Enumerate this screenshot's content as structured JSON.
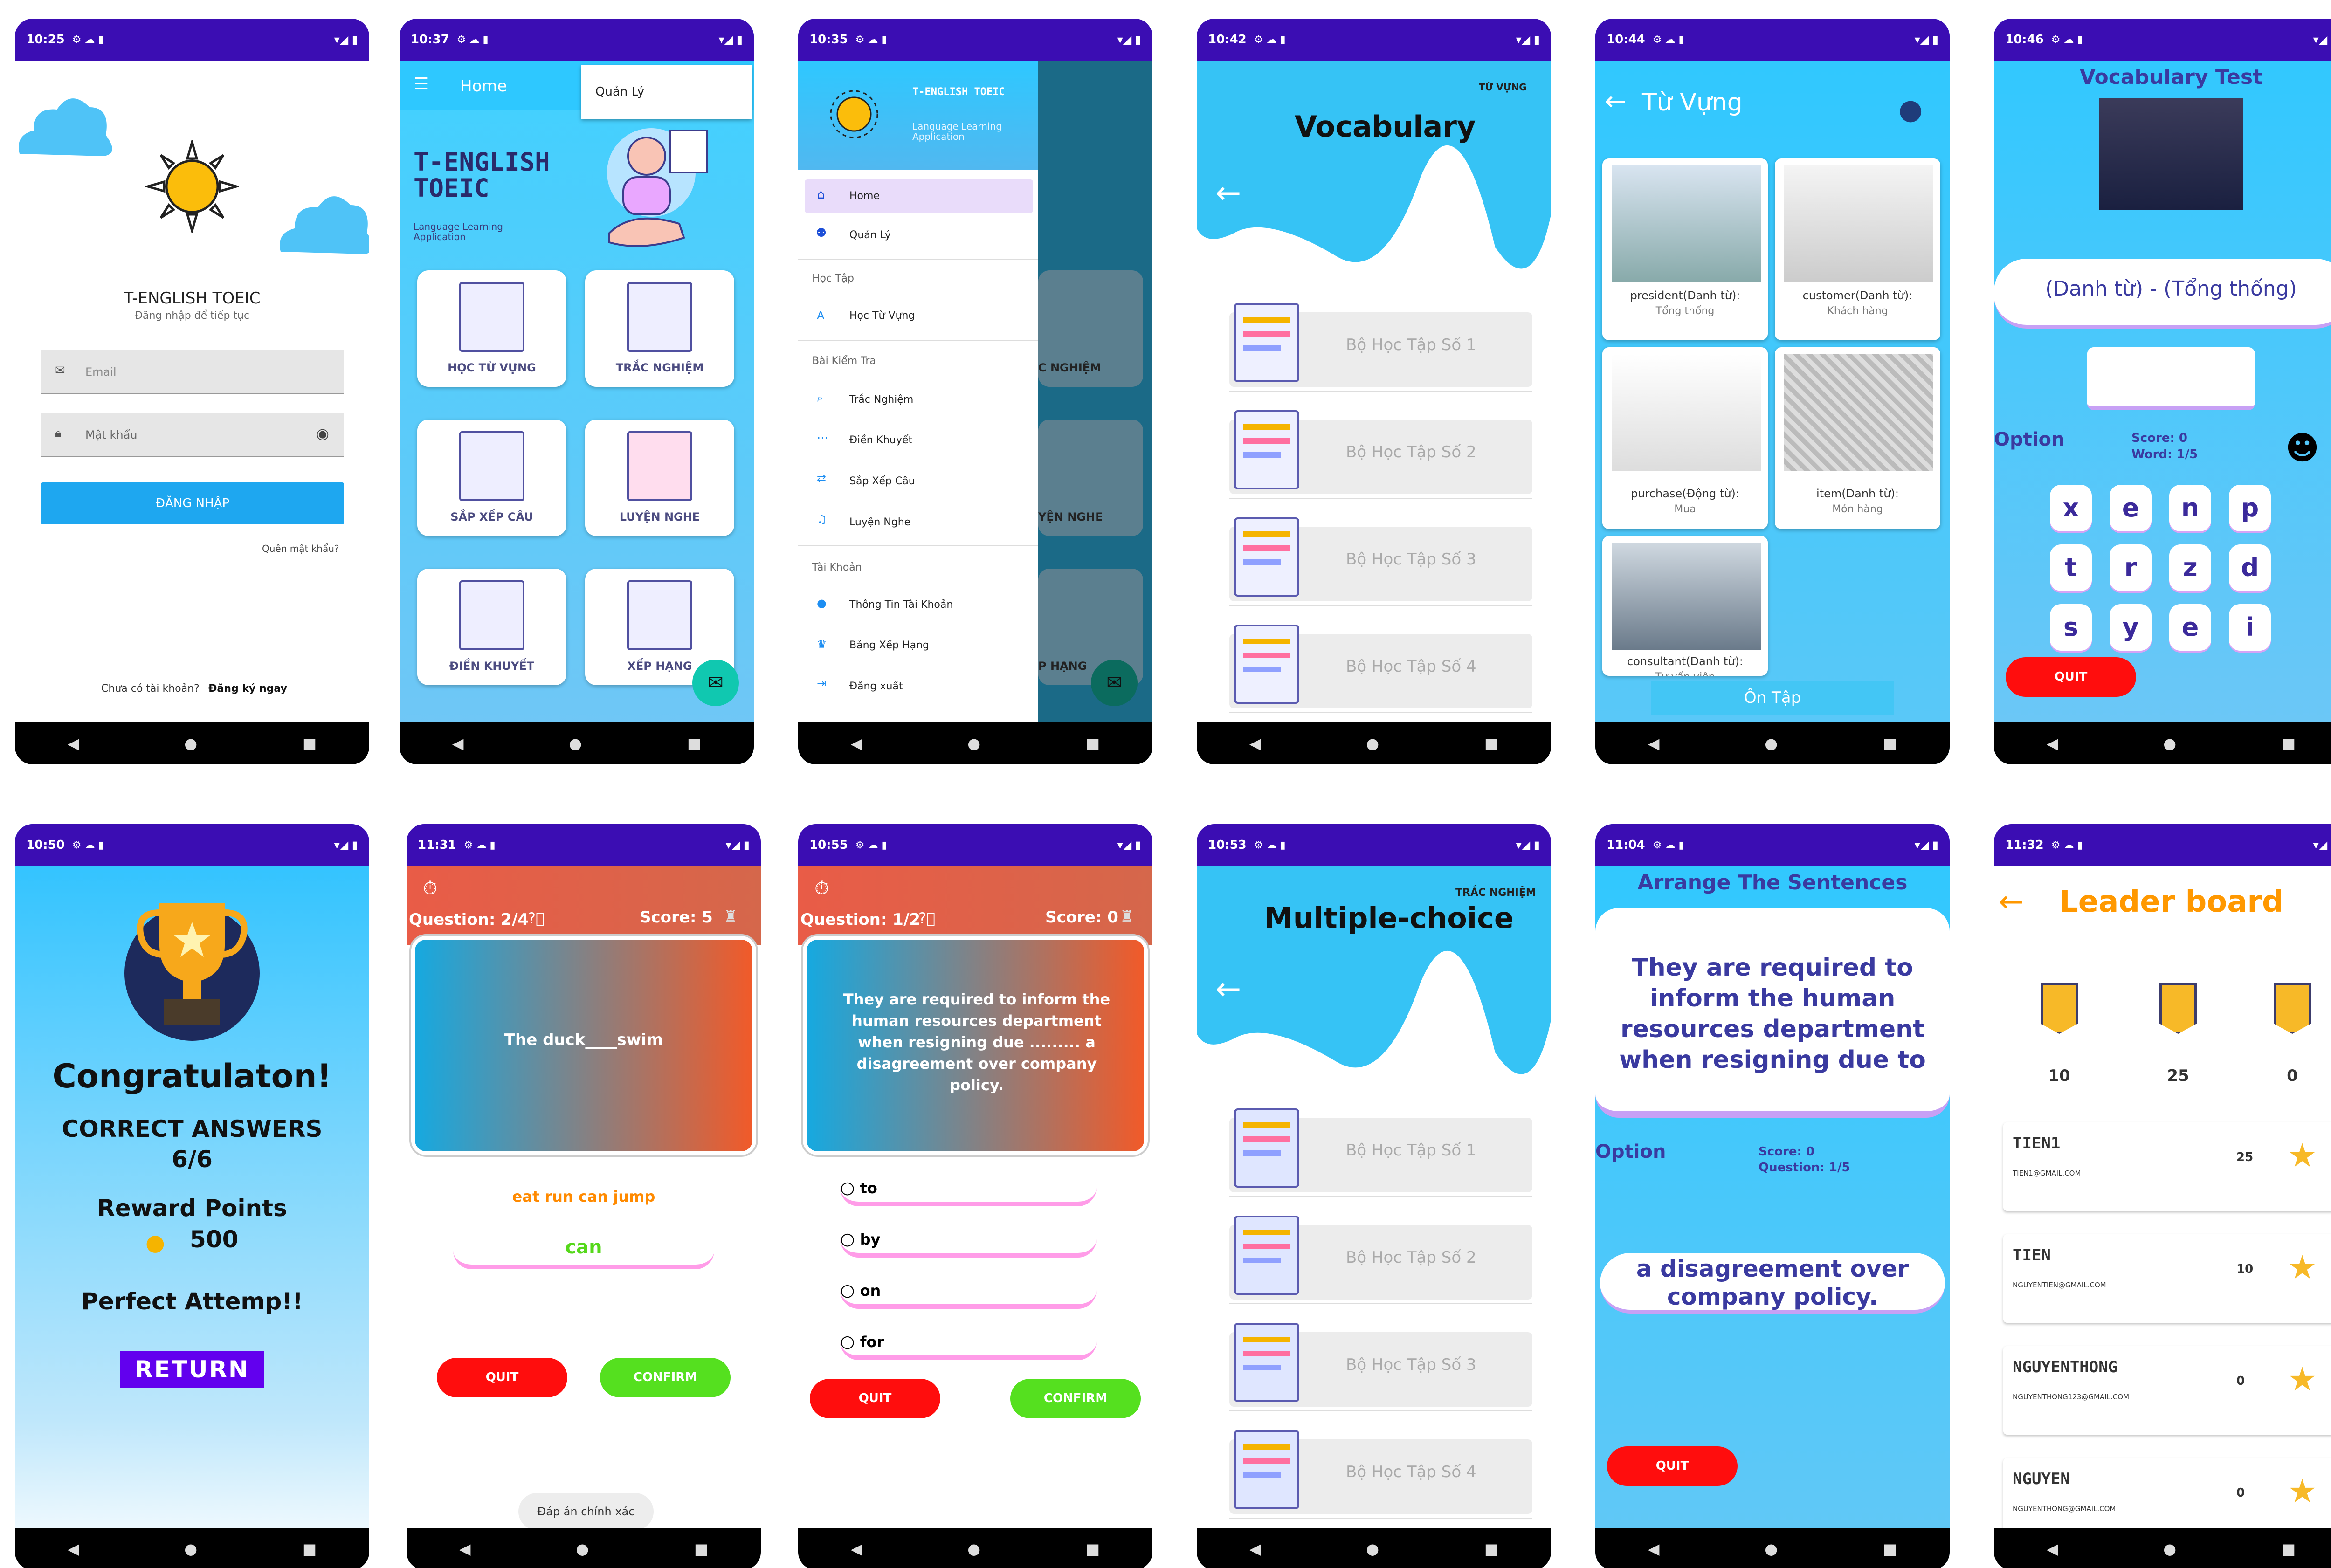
{
  "status": {
    "p1": "10:25",
    "p2": "10:37",
    "p3": "10:35",
    "p4": "10:42",
    "p5": "10:44",
    "p6": "10:46",
    "p7": "10:50",
    "p8": "11:31",
    "p9": "10:55",
    "p10": "10:53",
    "p11": "11:04",
    "p12": "11:32"
  },
  "login": {
    "title": "T-ENGLISH TOEIC",
    "subtitle": "Đăng nhập để tiếp tục",
    "email_placeholder": "Email",
    "password_placeholder": "Mật khẩu",
    "login_button": "ĐĂNG NHẬP",
    "forgot": "Quên mật khẩu?",
    "no_account": "Chưa có tài khoản?",
    "register": "Đăng ký ngay"
  },
  "home": {
    "toolbar_title": "Home",
    "popup_item": "Quản Lý",
    "brand_title_1": "T-ENGLISH",
    "brand_title_2": "TOEIC",
    "brand_sub_1": "Language Learning",
    "brand_sub_2": "Application",
    "tiles": [
      "HỌC TỪ VỰNG",
      "TRẮC NGHIỆM",
      "SẮP XẾP CÂU",
      "LUYỆN NGHE",
      "ĐIỀN KHUYẾT",
      "XẾP HẠNG"
    ]
  },
  "drawer": {
    "title": "T-ENGLISH TOEIC",
    "sub_1": "Language Learning",
    "sub_2": "Application",
    "items": {
      "home": "Home",
      "manage": "Quản Lý",
      "study_header": "Học Tập",
      "vocab": "Học Từ Vựng",
      "test_header": "Bài Kiểm Tra",
      "quiz": "Trắc Nghiệm",
      "fill": "Điền Khuyết",
      "arrange": "Sắp Xếp Câu",
      "listen": "Luyện Nghe",
      "account_header": "Tài Khoản",
      "info": "Thông Tin Tài Khoản",
      "rank": "Bảng Xếp Hạng",
      "logout": "Đăng xuất"
    },
    "behind": [
      "C NGHIỆM",
      "YỆN NGHE",
      "P HẠNG"
    ]
  },
  "vocab_sets": {
    "tag": "TỪ VỰNG",
    "title": "Vocabulary",
    "sets": [
      "Bộ Học Tập Số 1",
      "Bộ Học Tập Số 2",
      "Bộ Học Tập Số 3",
      "Bộ Học Tập Số 4"
    ]
  },
  "words": {
    "title": "Từ Vựng",
    "items": [
      {
        "word": "president(Danh từ):",
        "meaning": "Tổng thống"
      },
      {
        "word": "customer(Danh từ):",
        "meaning": "Khách hàng"
      },
      {
        "word": "purchase(Động từ):",
        "meaning": "Mua"
      },
      {
        "word": "item(Danh từ):",
        "meaning": "Món hàng"
      },
      {
        "word": "consultant(Danh từ):",
        "meaning": "Tư vấn viên"
      }
    ],
    "review_button": "Ôn Tập"
  },
  "vtest": {
    "title": "Vocabulary Test",
    "question": "(Danh từ) - (Tổng thống)",
    "option_label": "Option",
    "score": "Score: 0",
    "word": "Word: 1/5",
    "keys": [
      "x",
      "e",
      "n",
      "p",
      "t",
      "r",
      "z",
      "d",
      "s",
      "y",
      "e",
      "i"
    ],
    "quit": "QUIT"
  },
  "congrats": {
    "title": "Congratulaton!",
    "correct_label": "CORRECT ANSWERS",
    "correct_value": "6/6",
    "reward_label": "Reward Points",
    "reward_value": "500",
    "perfect": "Perfect Attemp!!",
    "return": "RETURN"
  },
  "fill": {
    "question": "Question: 2/4",
    "score": "Score: 5",
    "sentence": "The duck____swim",
    "options": "eat run can jump",
    "answer": "can",
    "quit": "QUIT",
    "confirm": "CONFIRM",
    "toast": "Đáp án chính xác"
  },
  "mc": {
    "question": "Question: 1/2",
    "score": "Score: 0",
    "sentence": "They are required to inform the human resources department when resigning due ......... a disagreement over company policy.",
    "options": [
      "to",
      "by",
      "on",
      "for"
    ],
    "quit": "QUIT",
    "confirm": "CONFIRM"
  },
  "mc_sets": {
    "tag": "TRẮC NGHIỆM",
    "title": "Multiple-choice",
    "sets": [
      "Bộ Học Tập Số 1",
      "Bộ Học Tập Số 2",
      "Bộ Học Tập Số 3",
      "Bộ Học Tập Số 4"
    ]
  },
  "arrange": {
    "title": "Arrange The Sentences",
    "sentence": "They are required to inform the human resources department when resigning due to",
    "option_label": "Option",
    "score": "Score: 0",
    "question": "Question: 1/5",
    "chunk": "a disagreement over company policy.",
    "quit": "QUIT"
  },
  "leader": {
    "title": "Leader board",
    "top": [
      "10",
      "25",
      "0"
    ],
    "rows": [
      {
        "name": "TIEN1",
        "email": "TIEN1@GMAIL.COM",
        "score": "25"
      },
      {
        "name": "TIEN",
        "email": "NGUYENTIEN@GMAIL.COM",
        "score": "10"
      },
      {
        "name": "NGUYENTHONG",
        "email": "NGUYENTHONG123@GMAIL.COM",
        "score": "0"
      },
      {
        "name": "NGUYEN",
        "email": "NGUYENTHONG@GMAIL.COM",
        "score": "0"
      }
    ]
  },
  "colors": {
    "status": "#3b0db3",
    "sky": "#2ec8ff",
    "accent": "#ff9800",
    "red": "#ff1a1a",
    "green": "#55e01f"
  }
}
